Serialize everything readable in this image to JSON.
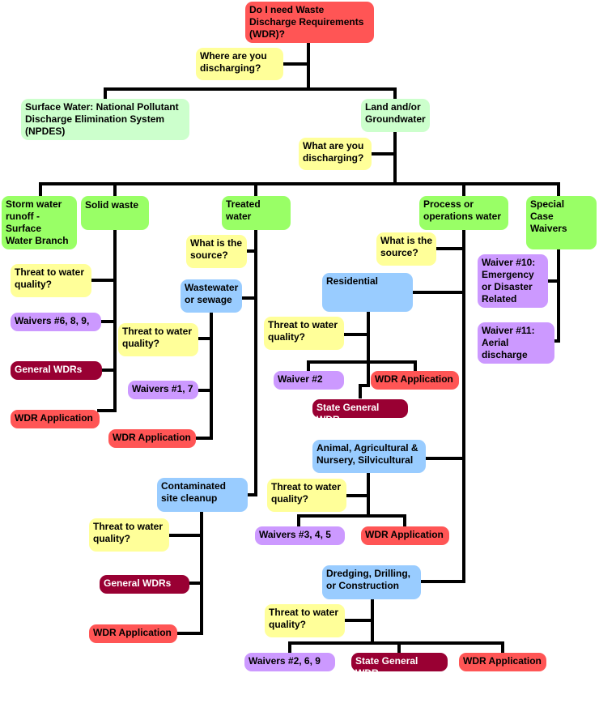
{
  "title": "Do I need Waste Discharge Requirements (WDR)?",
  "colors": {
    "root": "#ff5555",
    "question": "#ffff99",
    "destination": "#ccffcc",
    "category": "#99ff66",
    "source": "#99ccff",
    "waiver": "#cc99ff",
    "general_wdr": "#990033",
    "wdr_application": "#ff5555",
    "connector": "#000000"
  },
  "nodes": {
    "root": "Do I need Waste\nDischarge Requirements\n(WDR)?",
    "q_where": "Where are you\ndischarging?",
    "surface_water": "Surface Water: National Pollutant\nDischarge Elimination System\n(NPDES)",
    "land_groundwater": "Land and/or\nGroundwater",
    "q_what": "What are you\ndischarging?",
    "storm_water": "Storm water\nrunoff -\nSurface\nWater Branch",
    "solid_waste": "Solid waste",
    "treated_water": "Treated\nwater",
    "process_water": "Process or\noperations water",
    "special_case": "Special\nCase\nWaivers",
    "sw_threat": "Threat to water\nquality?",
    "sw_waivers": "Waivers #6, 8, 9,",
    "sw_general": "General WDRs",
    "sw_app": "WDR Application",
    "tw_source_q": "What is the\nsource?",
    "wastewater": "Wastewater\nor sewage",
    "ww_threat": "Threat to water\nquality?",
    "ww_waivers": "Waivers #1, 7",
    "ww_app": "WDR Application",
    "contaminated": "Contaminated\nsite cleanup",
    "cs_threat": "Threat to water\nquality?",
    "cs_general": "General WDRs",
    "cs_app": "WDR Application",
    "pw_source_q": "What is the\nsource?",
    "residential": "Residential",
    "res_threat": "Threat to water\nquality?",
    "res_waiver": "Waiver #2",
    "res_app": "WDR Application",
    "res_state": "State General WDR",
    "animal": "Animal, Agricultural &\nNursery, Silvicultural",
    "an_threat": "Threat to water\nquality?",
    "an_waivers": "Waivers #3, 4, 5",
    "an_app": "WDR Application",
    "dredging": "Dredging, Drilling,\nor Construction",
    "dr_threat": "Threat to water\nquality?",
    "dr_waivers": "Waivers #2, 6, 9",
    "dr_state": "State General WDR",
    "dr_app": "WDR Application",
    "waiver10": "Waiver #10:\nEmergency\nor Disaster\nRelated",
    "waiver11": "Waiver #11:\nAerial\ndischarge"
  }
}
